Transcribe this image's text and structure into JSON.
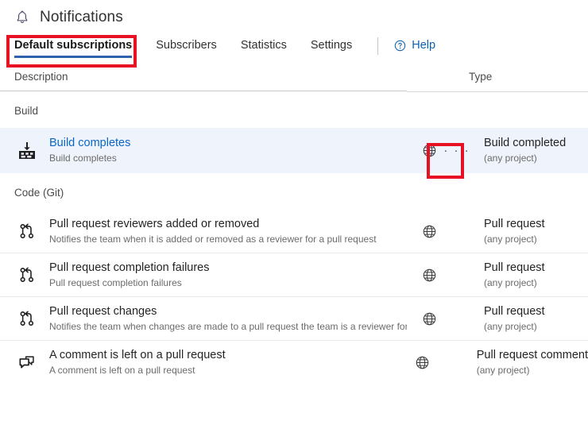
{
  "header": {
    "title": "Notifications",
    "bell_icon": "bell-icon"
  },
  "tabs": [
    {
      "label": "Default subscriptions",
      "active": true
    },
    {
      "label": "Subscribers",
      "active": false
    },
    {
      "label": "Statistics",
      "active": false
    },
    {
      "label": "Settings",
      "active": false
    }
  ],
  "help": {
    "label": "Help",
    "icon": "question-circle-icon"
  },
  "table": {
    "columns": {
      "description": "Description",
      "type": "Type"
    },
    "groups": [
      {
        "name": "Build",
        "rows": [
          {
            "icon": "build-icon",
            "title": "Build completes",
            "subtitle": "Build completes",
            "title_is_link": true,
            "selected": true,
            "has_more_menu": true,
            "more_menu_label": "· · ·",
            "type_icon": "globe-icon",
            "type_name": "Build completed",
            "type_scope": "(any project)"
          }
        ]
      },
      {
        "name": "Code (Git)",
        "rows": [
          {
            "icon": "pull-request-icon",
            "title": "Pull request reviewers added or removed",
            "subtitle": "Notifies the team when it is added or removed as a reviewer for a pull request",
            "title_is_link": false,
            "selected": false,
            "has_more_menu": false,
            "type_icon": "globe-icon",
            "type_name": "Pull request",
            "type_scope": "(any project)"
          },
          {
            "icon": "pull-request-icon",
            "title": "Pull request completion failures",
            "subtitle": "Pull request completion failures",
            "title_is_link": false,
            "selected": false,
            "has_more_menu": false,
            "type_icon": "globe-icon",
            "type_name": "Pull request",
            "type_scope": "(any project)"
          },
          {
            "icon": "pull-request-icon",
            "title": "Pull request changes",
            "subtitle": "Notifies the team when changes are made to a pull request the team is a reviewer for",
            "title_is_link": false,
            "selected": false,
            "has_more_menu": false,
            "type_icon": "globe-icon",
            "type_name": "Pull request",
            "type_scope": "(any project)"
          },
          {
            "icon": "comment-icon",
            "title": "A comment is left on a pull request",
            "subtitle": "A comment is left on a pull request",
            "title_is_link": false,
            "selected": false,
            "has_more_menu": false,
            "type_icon": "globe-icon",
            "type_name": "Pull request comment",
            "type_scope": "(any project)"
          }
        ]
      }
    ]
  },
  "annotations": [
    {
      "target": "tab-default-subscriptions",
      "color": "#e81123"
    },
    {
      "target": "row-more-actions-button",
      "color": "#e81123"
    }
  ]
}
